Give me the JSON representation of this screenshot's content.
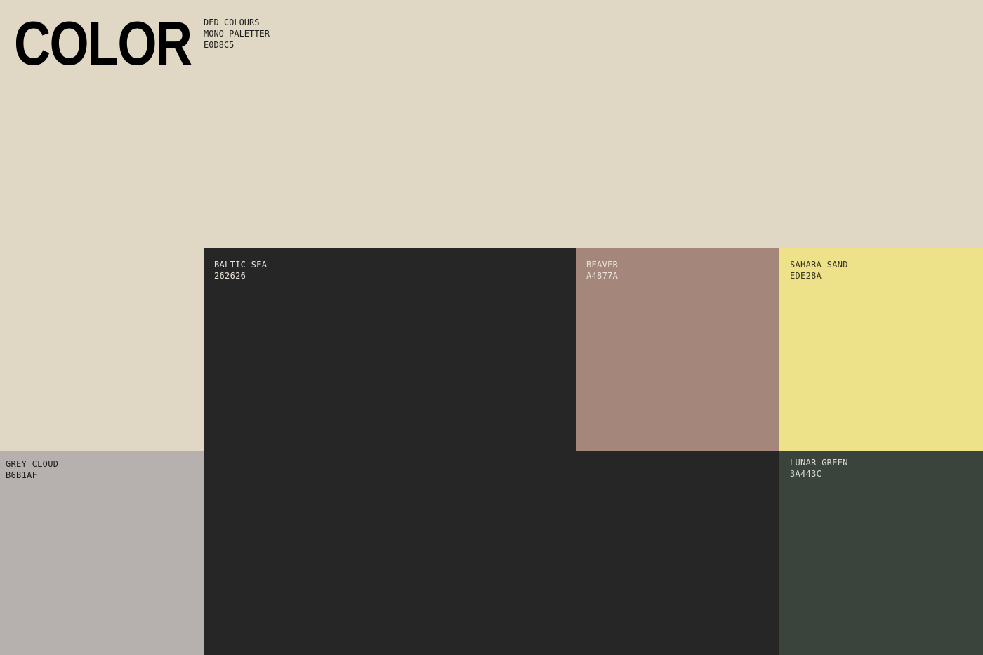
{
  "header": {
    "title": "COLOR",
    "meta": {
      "line1": "DED COLOURS",
      "line2": "MONO PALETTER",
      "line3": "E0D8C5"
    }
  },
  "background_color": "#E0D8C5",
  "swatches": {
    "baltic_sea": {
      "name": "BALTIC SEA",
      "hex": "262626",
      "color": "#262626"
    },
    "beaver": {
      "name": "BEAVER",
      "hex": "A4877A",
      "color": "#A4877A"
    },
    "sahara_sand": {
      "name": "SAHARA SAND",
      "hex": "EDE28A",
      "color": "#EDE28A"
    },
    "grey_cloud": {
      "name": "GREY CLOUD",
      "hex": "B6B1AF",
      "color": "#B6B1AF"
    },
    "lunar_green": {
      "name": "LUNAR GREEN",
      "hex": "3A443C",
      "color": "#3A443C"
    }
  }
}
